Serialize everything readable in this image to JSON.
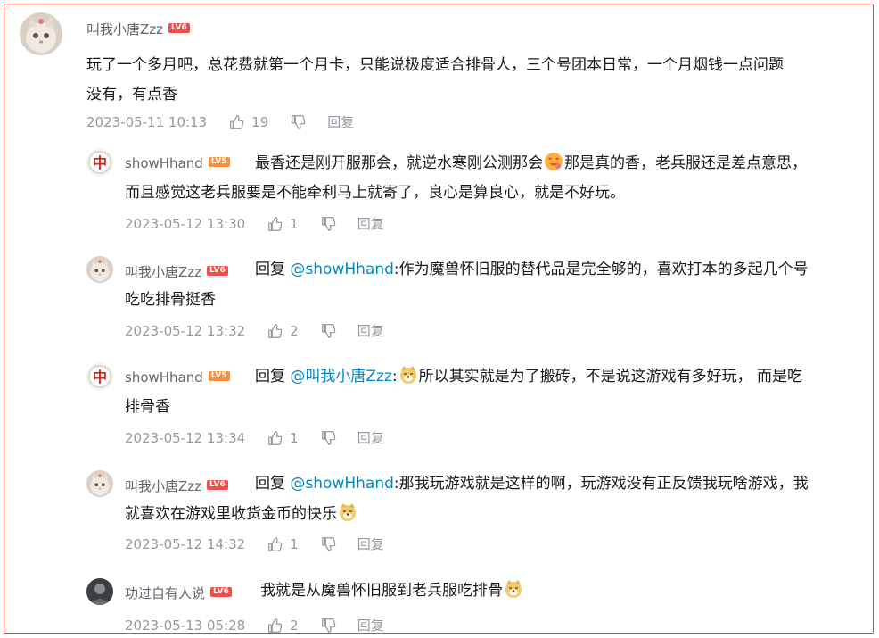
{
  "comments": [
    {
      "user": "叫我小唐Zzz",
      "level": "LV6",
      "level_color": "#f04c49",
      "parts": [
        "玩了一个多月吧，总花费就第一个月卡，只能说极度适合排骨人，三个号团本日常，一个月烟钱一点问题",
        "没有，有点香"
      ],
      "time": "2023-05-11 10:13",
      "likes": "19",
      "reply_label": "回复"
    },
    {
      "user": "showHhand",
      "level": "LV5",
      "level_color": "#ff8e3a",
      "pre": "最香还是刚开服那会，就逆水寒刚公测那会",
      "post": "那是真的香，老兵服还是差点意思，",
      "line2": "而且感觉这老兵服要是不能牵利马上就寄了，良心是算良心，就是不好玩。",
      "time": "2023-05-12 13:30",
      "likes": "1",
      "reply_label": "回复"
    },
    {
      "user": "叫我小唐Zzz",
      "level": "LV6",
      "level_color": "#f04c49",
      "reply_word": "回复",
      "mention": "@showHhand",
      "body": ":作为魔兽怀旧服的替代品是完全够的，喜欢打本的多起几个号",
      "line2": "吃吃排骨挺香",
      "time": "2023-05-12 13:32",
      "likes": "2",
      "reply_label": "回复"
    },
    {
      "user": "showHhand",
      "level": "LV5",
      "level_color": "#ff8e3a",
      "reply_word": "回复",
      "mention": "@叫我小唐Zzz",
      "body": ":",
      "post": "所以其实就是为了搬砖，不是说这游戏有多好玩， 而是吃",
      "line2": "排骨香",
      "time": "2023-05-12 13:34",
      "likes": "1",
      "reply_label": "回复"
    },
    {
      "user": "叫我小唐Zzz",
      "level": "LV6",
      "level_color": "#f04c49",
      "reply_word": "回复",
      "mention": "@showHhand",
      "body": ":那我玩游戏就是这样的啊，玩游戏没有正反馈我玩啥游戏，我",
      "line2": "就喜欢在游戏里收货金币的快乐",
      "time": "2023-05-12 14:32",
      "likes": "1",
      "reply_label": "回复"
    },
    {
      "user": "功过自有人说",
      "level": "LV6",
      "level_color": "#f04c49",
      "body": "我就是从魔兽怀旧服到老兵服吃排骨",
      "time": "2023-05-13 05:28",
      "likes": "2",
      "reply_label": "回复"
    }
  ]
}
